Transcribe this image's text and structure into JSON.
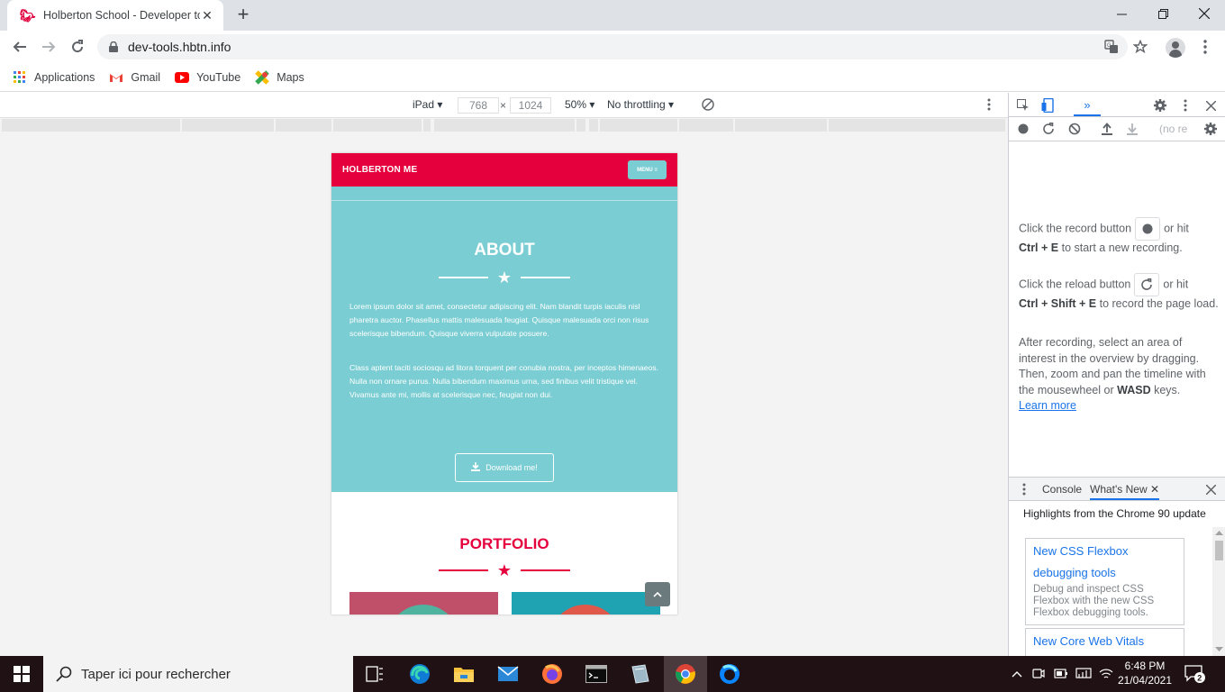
{
  "browser": {
    "tab_title": "Holberton School - Developer to",
    "url": "dev-tools.hbtn.info",
    "bookmarks": [
      {
        "label": "Applications",
        "icon": "apps-grid-icon"
      },
      {
        "label": "Gmail",
        "icon": "gmail-icon"
      },
      {
        "label": "YouTube",
        "icon": "youtube-icon"
      },
      {
        "label": "Maps",
        "icon": "maps-icon"
      }
    ]
  },
  "device_toolbar": {
    "device": "iPad",
    "width": "768",
    "times": "×",
    "height": "1024",
    "zoom": "50%",
    "throttling": "No throttling"
  },
  "site": {
    "brand": "HOLBERTON ME",
    "menu_label": "MENU ≡",
    "about_title": "ABOUT",
    "about_p1": "Lorem ipsum dolor sit amet, consectetur adipiscing elit. Nam blandit turpis iaculis nisl pharetra auctor. Phasellus mattis malesuada feugiat. Quisque malesuada orci non risus scelerisque bibendum. Quisque viverra vulputate posuere.",
    "about_p2": "Class aptent taciti sociosqu ad litora torquent per conubia nostra, per inceptos himenaeos. Nulla non ornare purus. Nulla bibendum maximus urna, sed finibus velit tristique vel. Vivamus ante mi, mollis at scelerisque nec, feugiat non dui.",
    "download_label": "Download me!",
    "portfolio_title": "PORTFOLIO",
    "colors": {
      "nav": "#e5003d",
      "about_bg": "#7acdd2",
      "thumb1": "#c0506a",
      "thumb2": "#1fa3b3"
    }
  },
  "devtools": {
    "record_text_a": "Click the record button",
    "record_text_b": "or hit",
    "record_keys": "Ctrl + E",
    "record_text_c": "to start a new recording.",
    "reload_text_a": "Click the reload button",
    "reload_text_b": "or hit",
    "reload_keys": "Ctrl + Shift + E",
    "reload_text_c": "to record the page load.",
    "after_text": "After recording, select an area of interest in the overview by dragging. Then, zoom and pan the timeline with the mousewheel or",
    "after_keys": "WASD",
    "after_tail": "keys.",
    "learn_more": "Learn more",
    "no_recording": "(no re",
    "drawer_tabs": [
      "Console",
      "What's New"
    ],
    "drawer_heading": "Highlights from the Chrome 90 update",
    "cards": [
      {
        "title": "New CSS Flexbox debugging tools",
        "desc": "Debug and inspect CSS Flexbox with the new CSS Flexbox debugging tools."
      },
      {
        "title": "New Core Web Vitals",
        "desc": ""
      }
    ]
  },
  "taskbar": {
    "search_placeholder": "Taper ici pour rechercher",
    "time": "6:48 PM",
    "date": "21/04/2021",
    "notification_count": "2"
  }
}
